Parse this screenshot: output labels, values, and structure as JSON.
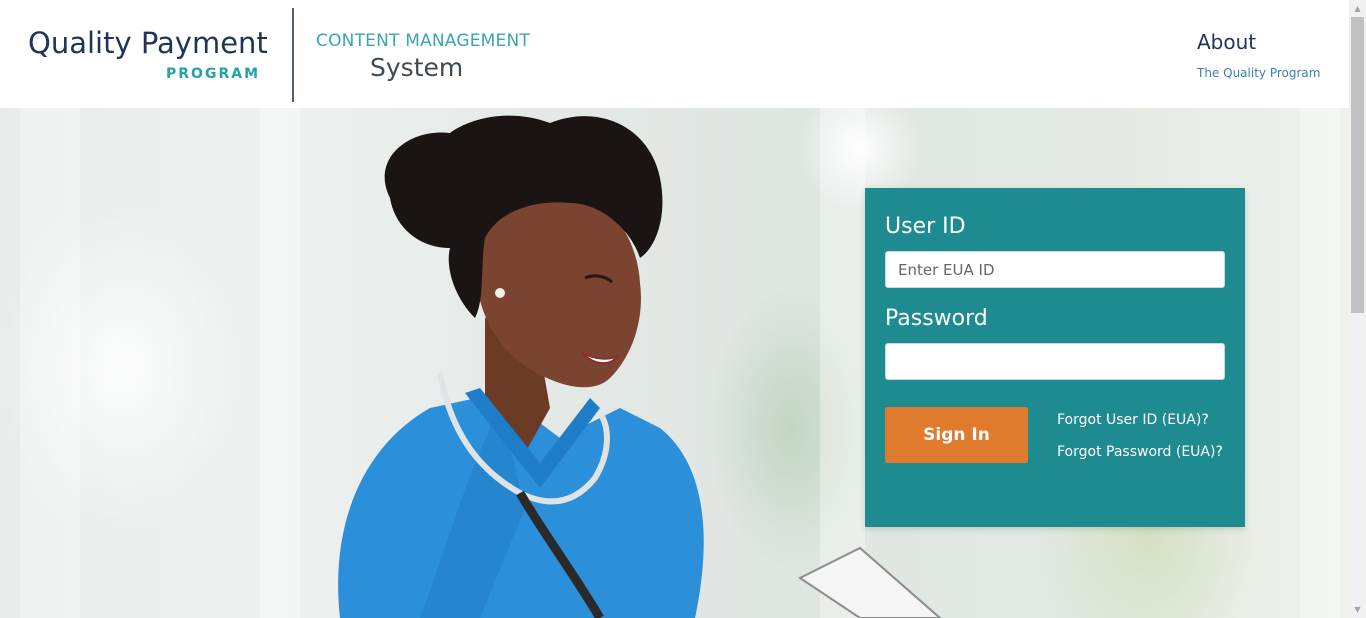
{
  "header": {
    "logo": {
      "line1": "Quality Payment",
      "line2": "PROGRAM"
    },
    "cms": {
      "line1": "CONTENT MANAGEMENT",
      "line2": "System"
    },
    "about": {
      "title": "About",
      "subtitle": "The Quality Program"
    }
  },
  "login": {
    "user_label": "User ID",
    "user_placeholder": "Enter EUA ID",
    "user_value": "",
    "password_label": "Password",
    "password_value": "",
    "signin_label": "Sign In",
    "forgot_user": "Forgot User ID (EUA)?",
    "forgot_password": "Forgot Password (EUA)?"
  },
  "colors": {
    "brand_navy": "#1f3456",
    "brand_teal": "#24a3a6",
    "card_bg": "#1e8b91",
    "signin_bg": "#e07b2e"
  },
  "icons": {
    "scroll_up": "scroll-up-arrow-icon",
    "scroll_down": "scroll-down-arrow-icon"
  }
}
